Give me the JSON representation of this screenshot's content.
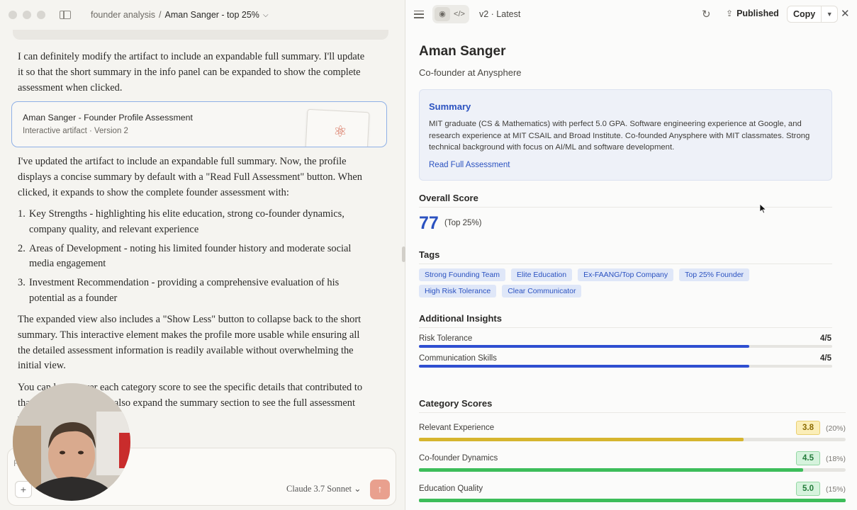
{
  "chat": {
    "breadcrumb_project": "founder analysis",
    "breadcrumb_separator": "/",
    "breadcrumb_title": "Aman Sanger - top 25%",
    "intro": "I can definitely modify the artifact to include an expandable full summary. I'll update it so that the short summary in the info panel can be expanded to show the complete assessment when clicked.",
    "artifact_card": {
      "title": "Aman Sanger - Founder Profile Assessment",
      "subtitle": "Interactive artifact · Version 2"
    },
    "update": "I've updated the artifact to include an expandable full summary. Now, the profile displays a concise summary by default with a \"Read Full Assessment\" button. When clicked, it expands to show the complete founder assessment with:",
    "list": [
      {
        "num": "1.",
        "text": "Key Strengths - highlighting his elite education, strong co-founder dynamics, company quality, and relevant experience"
      },
      {
        "num": "2.",
        "text": "Areas of Development - noting his limited founder history and moderate social media engagement"
      },
      {
        "num": "3.",
        "text": "Investment Recommendation - providing a comprehensive evaluation of his potential as a founder"
      }
    ],
    "expanded": "The expanded view also includes a \"Show Less\" button to collapse back to the short summary. This interactive element makes the profile more usable while ensuring all the detailed assessment information is readily available without overwhelming the initial view.",
    "hover_partial": "You can hover over each category score to see the specific details that contributed to that score, and you can also expand the summary section to see the full assessment with just one click.",
    "composer_placeholder": "R",
    "model_name": "Claude 3.7 Sonnet"
  },
  "artifact_bar": {
    "version": "v2 · Latest",
    "published": "Published",
    "copy": "Copy"
  },
  "profile": {
    "name": "Aman Sanger",
    "role": "Co-founder at Anysphere",
    "summary_heading": "Summary",
    "summary_text": "MIT graduate (CS & Mathematics) with perfect 5.0 GPA. Software engineering experience at Google, and research experience at MIT CSAIL and Broad Institute. Co-founded Anysphere with MIT classmates. Strong technical background with focus on AI/ML and software development.",
    "read_full": "Read Full Assessment",
    "overall_heading": "Overall Score",
    "overall_score": "77",
    "overall_note": "(Top 25%)",
    "tags_heading": "Tags",
    "tags": [
      "Strong Founding Team",
      "Elite Education",
      "Ex-FAANG/Top Company",
      "Top 25% Founder",
      "High Risk Tolerance",
      "Clear Communicator"
    ],
    "insights_heading": "Additional Insights",
    "insights": [
      {
        "label": "Risk Tolerance",
        "value": "4/5",
        "fraction": 0.8,
        "color": "#2f4fd0"
      },
      {
        "label": "Communication Skills",
        "value": "4/5",
        "fraction": 0.8,
        "color": "#2f4fd0"
      }
    ],
    "categories_heading": "Category Scores",
    "categories": [
      {
        "label": "Relevant Experience",
        "score": "3.8",
        "weight": "(20%)",
        "fraction": 0.76,
        "tone": "yellow",
        "color": "#d6b52e"
      },
      {
        "label": "Co-founder Dynamics",
        "score": "4.5",
        "weight": "(18%)",
        "fraction": 0.9,
        "tone": "green",
        "color": "#3dbd5a"
      },
      {
        "label": "Education Quality",
        "score": "5.0",
        "weight": "(15%)",
        "fraction": 1.0,
        "tone": "green",
        "color": "#3dbd5a"
      }
    ]
  }
}
